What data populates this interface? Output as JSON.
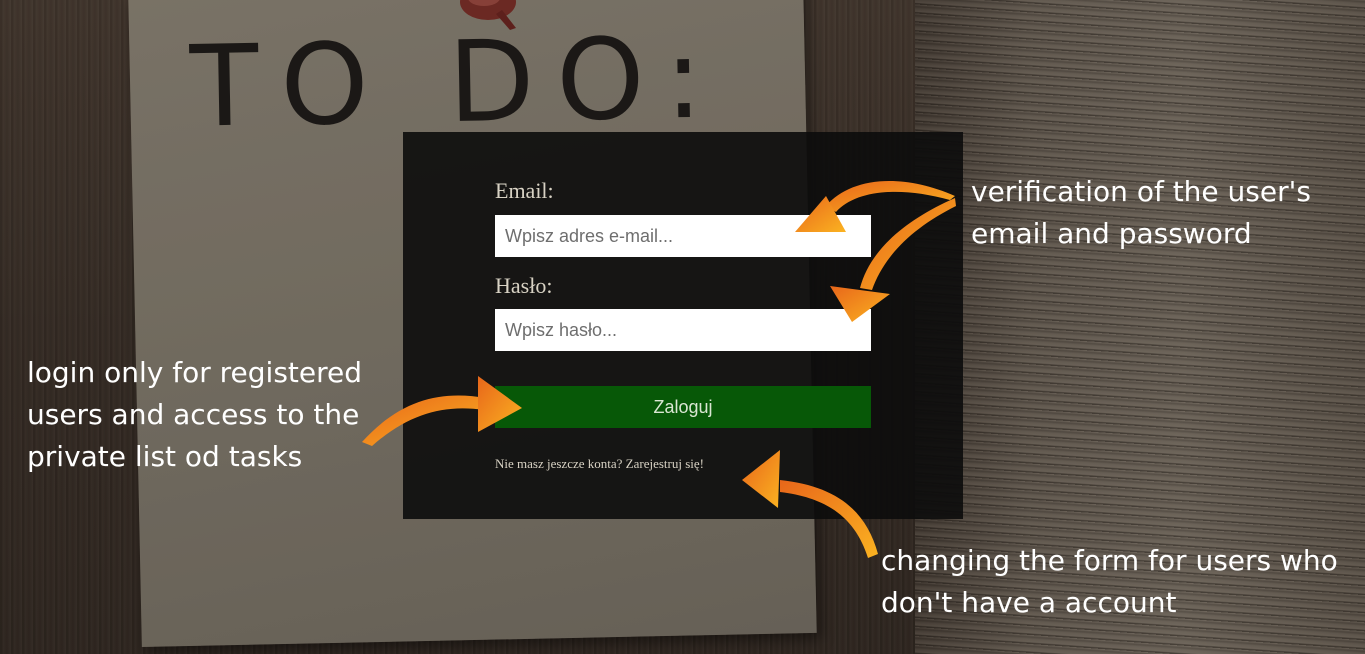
{
  "background": {
    "note_title": "TO DO:"
  },
  "login_form": {
    "email_label": "Email:",
    "email_placeholder": "Wpisz adres e-mail...",
    "password_label": "Hasło:",
    "password_placeholder": "Wpisz hasło...",
    "submit_label": "Zaloguj",
    "register_link": "Nie masz jeszcze konta? Zarejestruj się!"
  },
  "annotations": {
    "verification": [
      "verification of the user's",
      "email and password"
    ],
    "login_info": [
      "login only for registered",
      "users and access to the",
      "private list od tasks"
    ],
    "register_info": [
      "changing the form for users who",
      "don't have a account"
    ]
  },
  "colors": {
    "button": "#075807",
    "arrow": "#f7a21b",
    "panel": "#0c0c0c"
  },
  "icons": [
    "pushpin-icon",
    "arrow-icon"
  ]
}
